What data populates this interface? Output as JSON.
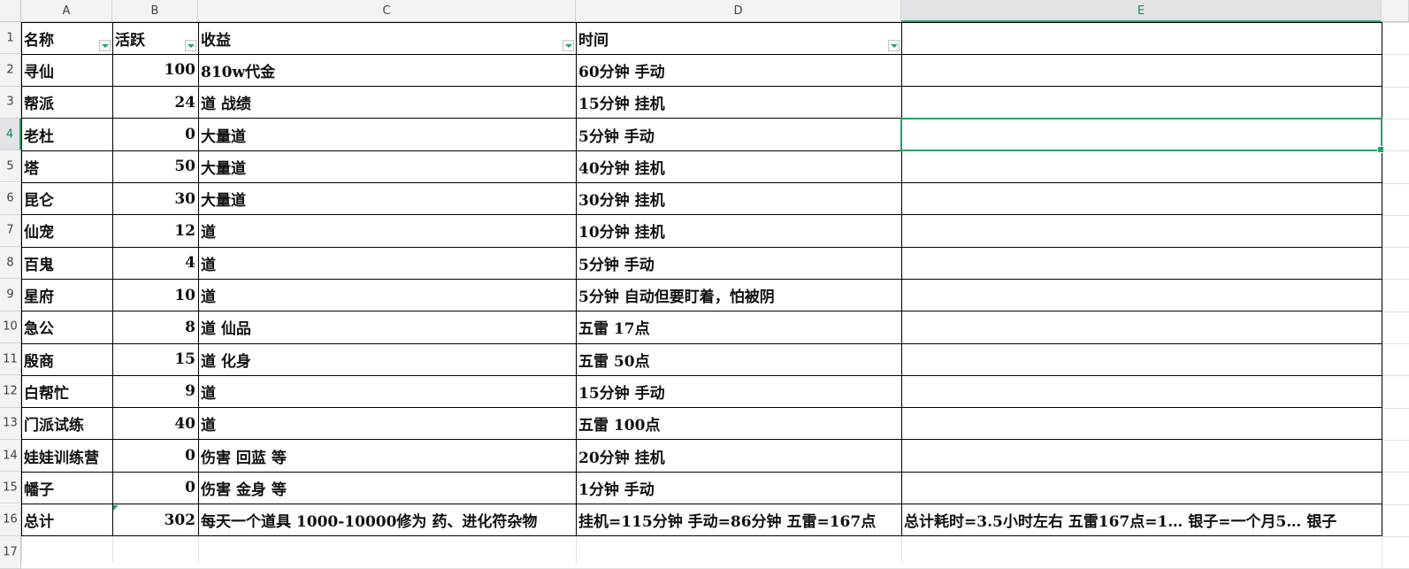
{
  "columns": [
    "A",
    "B",
    "C",
    "D",
    "E"
  ],
  "rows": [
    {
      "n": "1",
      "a": "名称",
      "b": "活跃",
      "c": "收益",
      "d": "时间",
      "e": ""
    },
    {
      "n": "2",
      "a": "寻仙",
      "b": "100",
      "c": "810w代金",
      "d": "60分钟  手动",
      "e": ""
    },
    {
      "n": "3",
      "a": "帮派",
      "b": "24",
      "c": "道  战绩",
      "d": "15分钟  挂机",
      "e": ""
    },
    {
      "n": "4",
      "a": "老杜",
      "b": "0",
      "c": "大量道",
      "d": "5分钟    手动",
      "e": ""
    },
    {
      "n": "5",
      "a": "塔",
      "b": "50",
      "c": "大量道",
      "d": "40分钟  挂机",
      "e": ""
    },
    {
      "n": "6",
      "a": "昆仑",
      "b": "30",
      "c": "大量道",
      "d": "30分钟  挂机",
      "e": ""
    },
    {
      "n": "7",
      "a": "仙宠",
      "b": "12",
      "c": "道",
      "d": "10分钟  挂机",
      "e": ""
    },
    {
      "n": "8",
      "a": "百鬼",
      "b": "4",
      "c": "道",
      "d": "5分钟    手动",
      "e": ""
    },
    {
      "n": "9",
      "a": "星府",
      "b": "10",
      "c": "道",
      "d": "5分钟    自动但要盯着，怕被阴",
      "e": ""
    },
    {
      "n": "10",
      "a": "急公",
      "b": "8",
      "c": "道  仙品",
      "d": "五雷    17点",
      "e": ""
    },
    {
      "n": "11",
      "a": "殷商",
      "b": "15",
      "c": "道  化身",
      "d": "五雷    50点",
      "e": ""
    },
    {
      "n": "12",
      "a": "白帮忙",
      "b": "9",
      "c": "道",
      "d": "15分钟  手动",
      "e": ""
    },
    {
      "n": "13",
      "a": "门派试练",
      "b": "40",
      "c": "道",
      "d": "五雷    100点",
      "e": ""
    },
    {
      "n": "14",
      "a": "娃娃训练营",
      "b": "0",
      "c": "伤害  回蓝  等",
      "d": "20分钟  挂机",
      "e": ""
    },
    {
      "n": "15",
      "a": "幡子",
      "b": "0",
      "c": "伤害  金身  等",
      "d": "1分钟    手动",
      "e": ""
    },
    {
      "n": "16",
      "a": "总计",
      "b": "302",
      "c": "每天一个道具  1000-10000修为  药、进化符杂物",
      "d": "挂机=115分钟  手动=86分钟  五雷=167点",
      "e": "总计耗时=3.5小时左右  五雷167点=1… 银子=一个月5… 银子"
    },
    {
      "n": "17",
      "a": "",
      "b": "",
      "c": "",
      "d": "",
      "e": ""
    }
  ],
  "selected_cell": "E4",
  "colors": {
    "accent": "#21a366",
    "header_bg": "#f3f3f3",
    "grid": "#000000"
  }
}
